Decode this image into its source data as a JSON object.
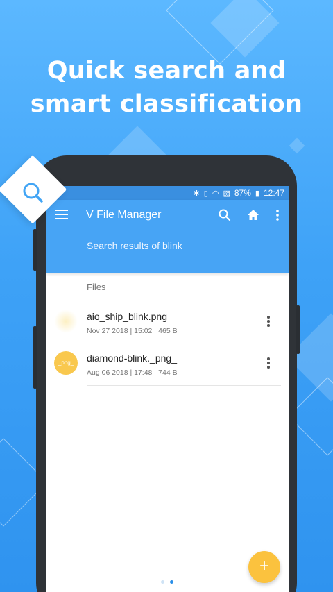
{
  "headline": {
    "line1": "Quick search and",
    "line2": "smart classification"
  },
  "status_bar": {
    "battery": "87%",
    "time": "12:47"
  },
  "app_bar": {
    "title": "V File Manager",
    "subtitle": "Search results of blink"
  },
  "section_header": "Files",
  "files": [
    {
      "name": "aio_ship_blink.png",
      "date": "Nov 27 2018 | 15:02",
      "size": "465 B",
      "thumb_label": ""
    },
    {
      "name": "diamond-blink._png_",
      "date": "Aug 06 2018 | 17:48",
      "size": "744 B",
      "thumb_label": "_png_"
    }
  ],
  "fab_label": "+",
  "pager": {
    "count": 2,
    "active": 2
  },
  "icons": {
    "search_badge": "search-icon",
    "menu": "menu-icon",
    "search": "search-icon",
    "home": "home-icon",
    "more": "more-vert-icon"
  },
  "colors": {
    "app_bar": "#47a4f5",
    "status_bar": "#3a8fe0",
    "fab": "#fbc23e",
    "thumb": "#f9c84e"
  }
}
